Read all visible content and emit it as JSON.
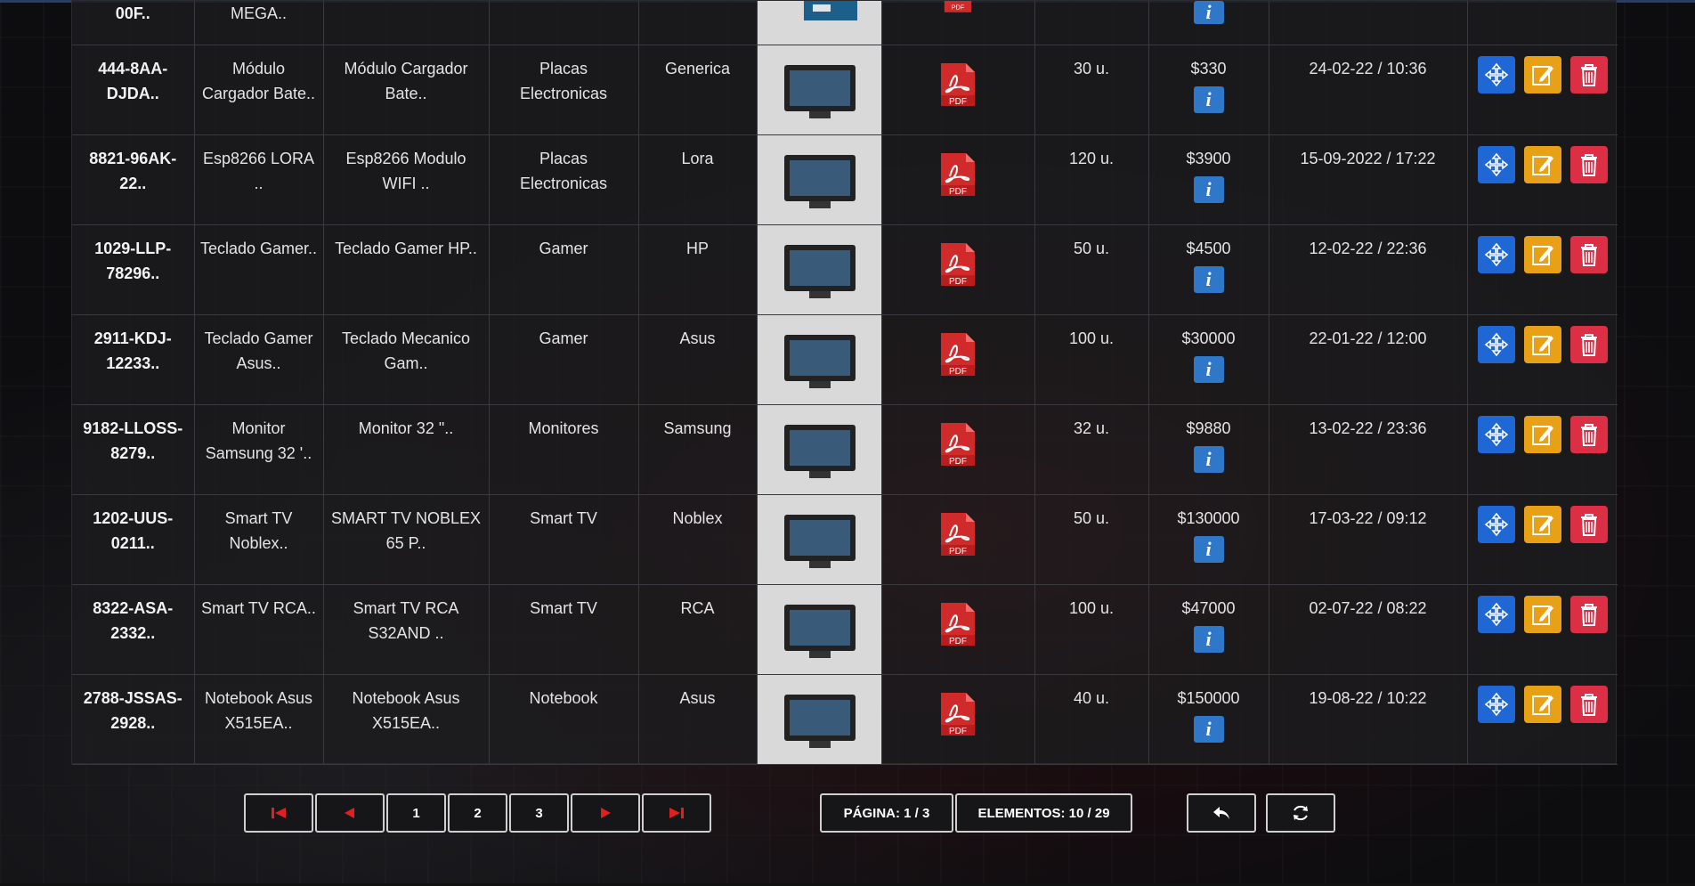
{
  "partial_row": {
    "code": "00F..",
    "name": "MEGA..",
    "pdf_label": "PDF"
  },
  "rows": [
    {
      "code": "444-8AA-DJDA..",
      "name": "Módulo Cargador Bate..",
      "desc": "Módulo Cargador Bate..",
      "category": "Placas Electronicas",
      "brand": "Generica",
      "stock": "30 u.",
      "price": "$330",
      "date": "24-02-22 / 10:36"
    },
    {
      "code": "8821-96AK-22..",
      "name": "Esp8266 LORA ..",
      "desc": "Esp8266 Modulo WIFI ..",
      "category": "Placas Electronicas",
      "brand": "Lora",
      "stock": "120 u.",
      "price": "$3900",
      "date": "15-09-2022 / 17:22"
    },
    {
      "code": "1029-LLP-78296..",
      "name": "Teclado Gamer..",
      "desc": "Teclado Gamer HP..",
      "category": "Gamer",
      "brand": "HP",
      "stock": "50 u.",
      "price": "$4500",
      "date": "12-02-22 / 22:36"
    },
    {
      "code": "2911-KDJ-12233..",
      "name": "Teclado Gamer Asus..",
      "desc": "Teclado Mecanico Gam..",
      "category": "Gamer",
      "brand": "Asus",
      "stock": "100 u.",
      "price": "$30000",
      "date": "22-01-22 / 12:00"
    },
    {
      "code": "9182-LLOSS-8279..",
      "name": "Monitor Samsung 32 '..",
      "desc": "Monitor 32 \"..",
      "category": "Monitores",
      "brand": "Samsung",
      "stock": "32 u.",
      "price": "$9880",
      "date": "13-02-22 / 23:36"
    },
    {
      "code": "1202-UUS-0211..",
      "name": "Smart TV Noblex..",
      "desc": "SMART TV NOBLEX 65 P..",
      "category": "Smart TV",
      "brand": "Noblex",
      "stock": "50 u.",
      "price": "$130000",
      "date": "17-03-22 / 09:12"
    },
    {
      "code": "8322-ASA-2332..",
      "name": "Smart TV RCA..",
      "desc": "Smart TV RCA S32AND ..",
      "category": "Smart TV",
      "brand": "RCA",
      "stock": "100 u.",
      "price": "$47000",
      "date": "02-07-22 / 08:22"
    },
    {
      "code": "2788-JSSAS-2928..",
      "name": "Notebook Asus X515EA..",
      "desc": "Notebook Asus X515EA..",
      "category": "Notebook",
      "brand": "Asus",
      "stock": "40 u.",
      "price": "$150000",
      "date": "19-08-22 / 10:22"
    }
  ],
  "labels": {
    "pdf": "PDF",
    "info": "i"
  },
  "pagination": {
    "pages": [
      "1",
      "2",
      "3"
    ],
    "page_info": "PÁGINA: 1 / 3",
    "elements_info": "ELEMENTOS: 10 / 29"
  },
  "icons": {
    "first": "first-page-icon",
    "prev": "prev-page-icon",
    "next": "next-page-icon",
    "last": "last-page-icon",
    "back": "back-arrow-icon",
    "refresh": "refresh-icon",
    "move": "move-arrows-icon",
    "edit": "edit-pencil-icon",
    "delete": "trash-icon",
    "pdf": "pdf-file-icon",
    "info": "info-icon"
  },
  "colors": {
    "move": "#1f67d4",
    "edit": "#e8a117",
    "delete": "#dc2e45",
    "info": "#2f77c9",
    "pdf": "#d12a2a"
  }
}
